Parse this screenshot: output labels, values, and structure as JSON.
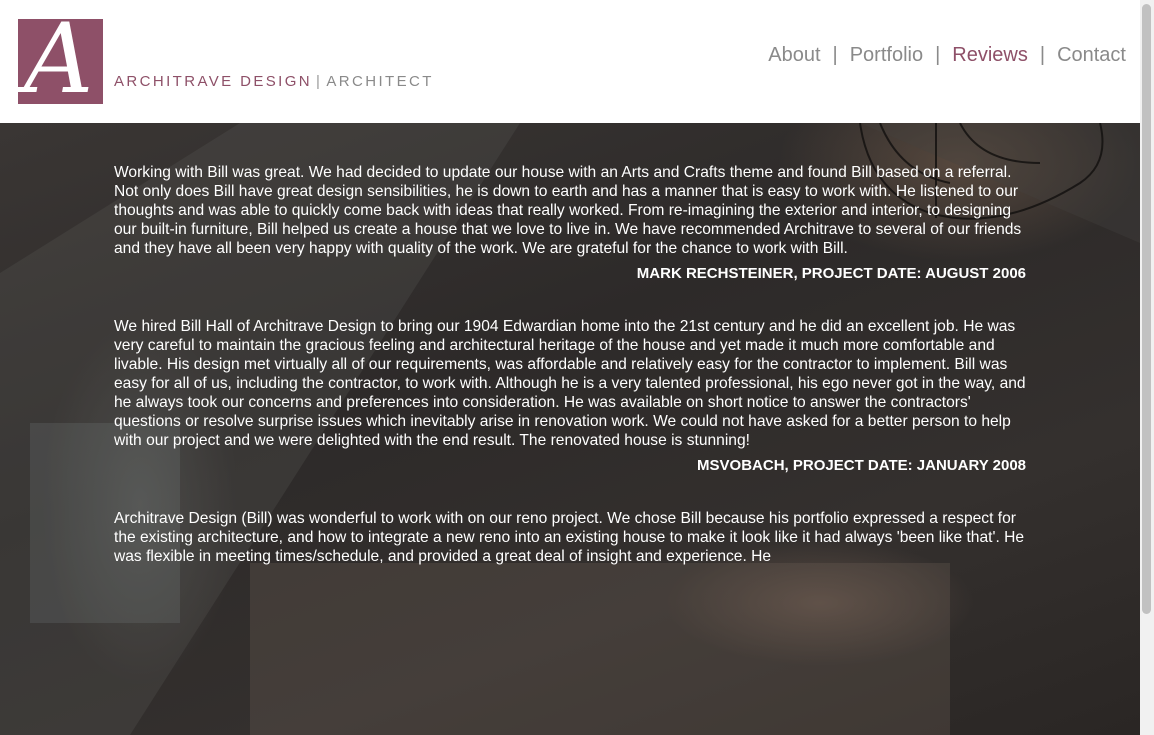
{
  "brand": {
    "logo_letter": "A",
    "name": "ARCHITRAVE DESIGN",
    "separator": "|",
    "subtitle": "ARCHITECT",
    "accent_color": "#8e5068"
  },
  "nav": {
    "items": [
      {
        "label": "About",
        "active": false
      },
      {
        "label": "Portfolio",
        "active": false
      },
      {
        "label": "Reviews",
        "active": true
      },
      {
        "label": "Contact",
        "active": false
      }
    ],
    "separator": "|"
  },
  "reviews": [
    {
      "text": "Working with Bill was great. We had decided to update our house with an Arts and Crafts theme and found Bill based on a referral. Not only does Bill have great design sensibilities, he is down to earth and has a manner that is easy to work with. He listened to our thoughts and was able to quickly come back with ideas that really worked. From re-imagining the exterior and interior, to designing our built-in furniture, Bill helped us create a house that we love to live in. We have recommended Architrave to several of our friends and they have all been very happy with quality of the work. We are grateful for the chance to work with Bill.",
      "author": "MARK RECHSTEINER, PROJECT DATE: AUGUST 2006"
    },
    {
      "text": "We hired Bill Hall of Architrave Design to bring our 1904 Edwardian home into the 21st century and he did an excellent job. He was very careful to maintain the gracious feeling and architectural heritage of the house and yet made it much more comfortable and livable. His design met virtually all of our requirements, was affordable and relatively easy for the contractor to implement. Bill was easy for all of us, including the contractor, to work with. Although he is a very talented professional, his ego never got in the way, and he always took our concerns and preferences into consideration. He was available on short notice to answer the contractors' questions or resolve surprise issues which inevitably arise in renovation work. We could not have asked for a better person to help with our project and we were delighted with the end result. The renovated house is stunning!",
      "author": "MSVOBACH, PROJECT DATE: JANUARY 2008"
    },
    {
      "text": "Architrave Design (Bill) was wonderful to work with on our reno project. We chose Bill because his portfolio expressed a respect for the existing architecture, and how to integrate a new reno into an existing house to make it look like it had always 'been like that'. He was flexible in meeting times/schedule, and provided a great deal of insight and experience. He",
      "author": ""
    }
  ]
}
